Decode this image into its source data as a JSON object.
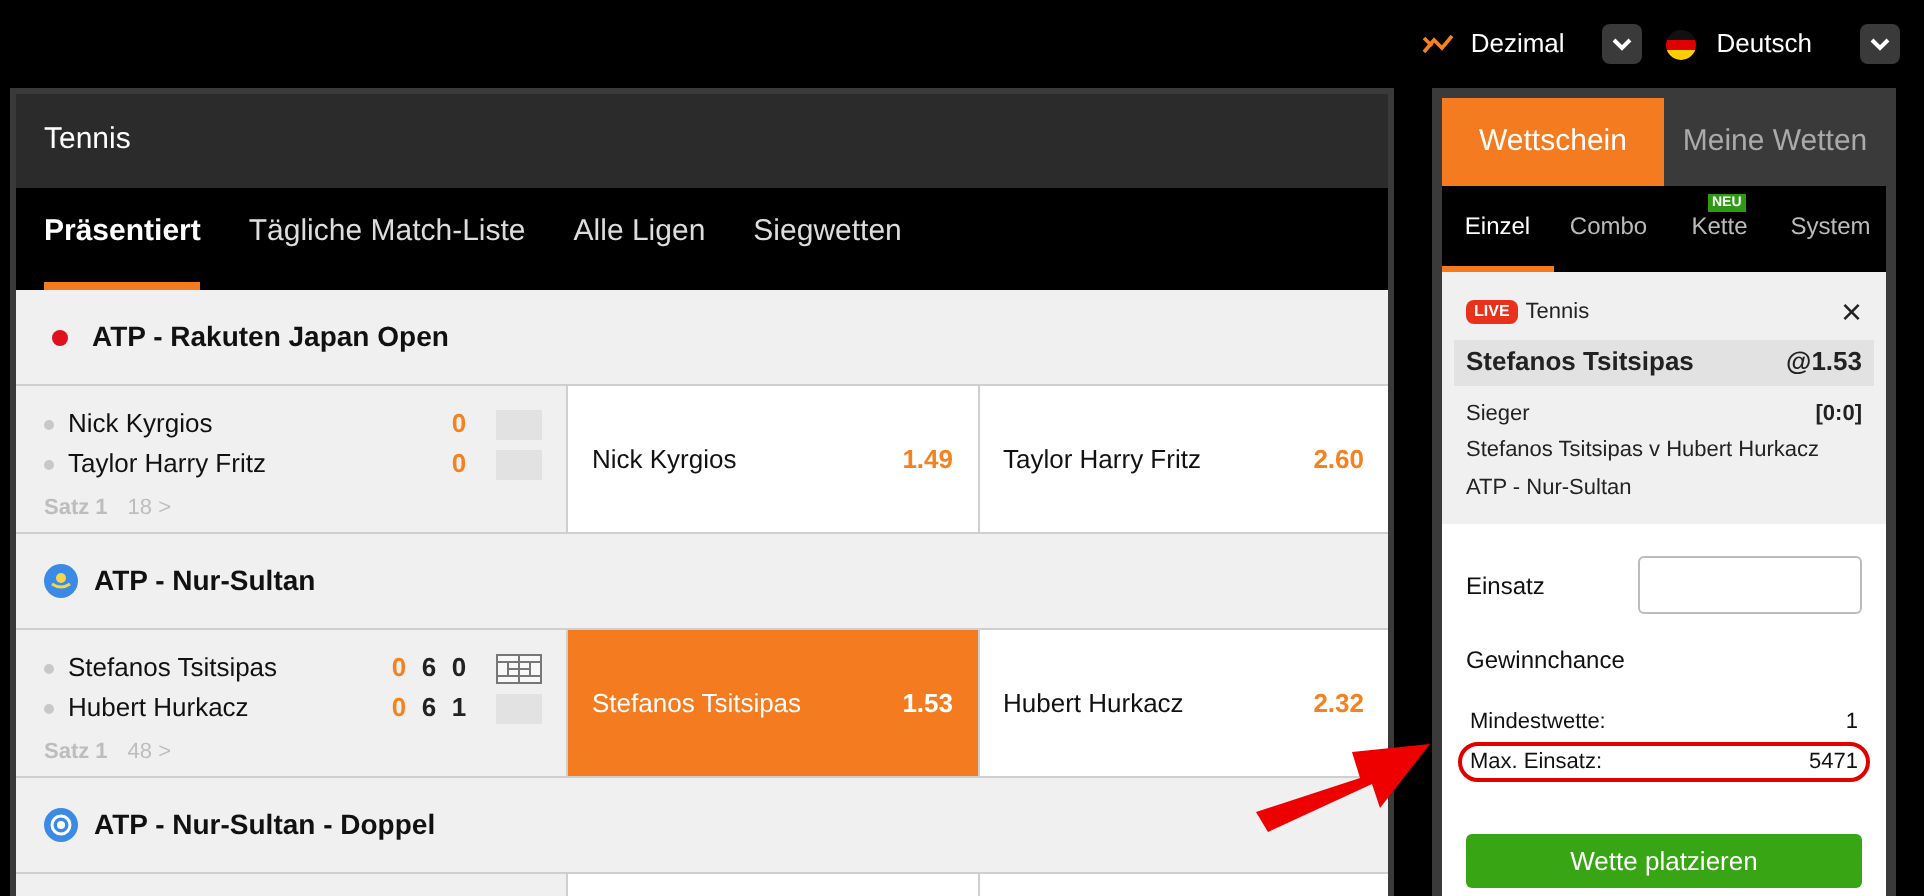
{
  "top_bar": {
    "odds_format": "Dezimal",
    "language": "Deutsch"
  },
  "sport": {
    "title": "Tennis",
    "tabs": [
      {
        "label": "Präsentiert",
        "selected": true
      },
      {
        "label": "Tägliche Match-Liste",
        "selected": false
      },
      {
        "label": "Alle Ligen",
        "selected": false
      },
      {
        "label": "Siegwetten",
        "selected": false
      }
    ],
    "leagues": [
      {
        "name": "ATP - Rakuten Japan Open",
        "kind": "dot",
        "matches": [
          {
            "court_icon": false,
            "set": "Satz 1",
            "markets": "18 >",
            "players": [
              {
                "name": "Nick Kyrgios",
                "scores": [
                  "0"
                ]
              },
              {
                "name": "Taylor Harry Fritz",
                "scores": [
                  "0"
                ]
              }
            ],
            "odds": [
              {
                "name": "Nick Kyrgios",
                "price": "1.49",
                "selected": false
              },
              {
                "name": "Taylor Harry Fritz",
                "price": "2.60",
                "selected": false
              }
            ]
          }
        ]
      },
      {
        "name": "ATP - Nur-Sultan",
        "kind": "sun",
        "matches": [
          {
            "court_icon": true,
            "set": "Satz 1",
            "markets": "48 >",
            "players": [
              {
                "name": "Stefanos Tsitsipas",
                "scores": [
                  "0",
                  "6",
                  "0"
                ]
              },
              {
                "name": "Hubert Hurkacz",
                "scores": [
                  "0",
                  "6",
                  "1"
                ]
              }
            ],
            "odds": [
              {
                "name": "Stefanos Tsitsipas",
                "price": "1.53",
                "selected": true
              },
              {
                "name": "Hubert Hurkacz",
                "price": "2.32",
                "selected": false
              }
            ]
          }
        ]
      },
      {
        "name": "ATP - Nur-Sultan - Doppel",
        "kind": "wreath"
      }
    ]
  },
  "bet_slip": {
    "tabs": [
      {
        "label": "Wettschein",
        "selected": true
      },
      {
        "label": "Meine Wetten",
        "selected": false
      }
    ],
    "bet_types": [
      {
        "label": "Einzel",
        "selected": true
      },
      {
        "label": "Combo",
        "selected": false
      },
      {
        "label": "Kette",
        "selected": false,
        "badge": "NEU"
      },
      {
        "label": "System",
        "selected": false
      }
    ],
    "selection": {
      "live_badge": "LIVE",
      "sport": "Tennis",
      "close": "×",
      "name": "Stefanos Tsitsipas",
      "odds": "@1.53",
      "market": "Sieger",
      "score": "[0:0]",
      "event": "Stefanos Tsitsipas v Hubert Hurkacz",
      "league": "ATP - Nur-Sultan"
    },
    "stake_label": "Einsatz",
    "win_label": "Gewinnchance",
    "limits": [
      {
        "label": "Mindestwette:",
        "value": "1",
        "highlighted": false
      },
      {
        "label": "Max. Einsatz:",
        "value": "5471",
        "highlighted": true
      }
    ],
    "place_button": "Wette platzieren"
  },
  "annotation_arrow": true
}
